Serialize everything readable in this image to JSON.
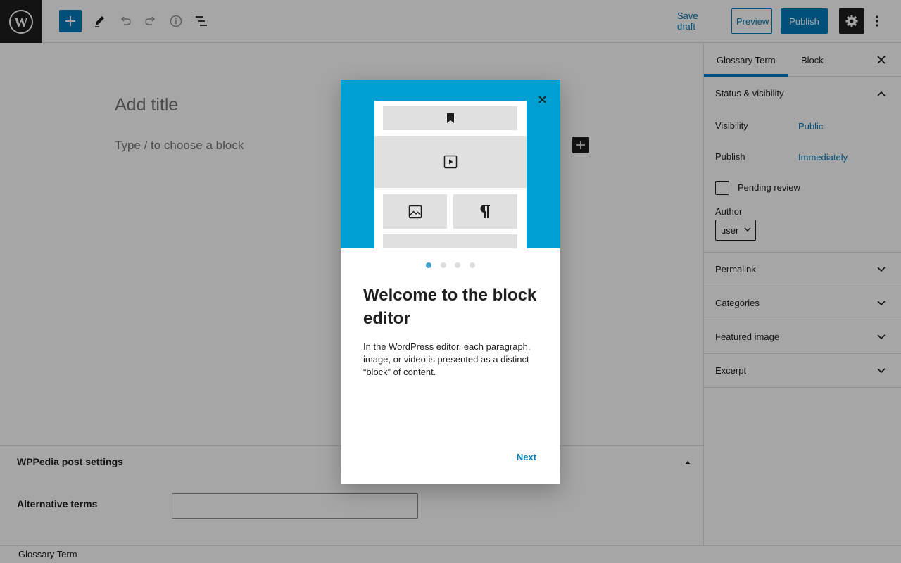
{
  "toolbar": {
    "save_draft": "Save draft",
    "preview": "Preview",
    "publish": "Publish"
  },
  "editor": {
    "title_placeholder": "Add title",
    "block_placeholder": "Type / to choose a block"
  },
  "metabox": {
    "title": "WPPedia post settings",
    "alt_terms_label": "Alternative terms",
    "alt_terms_value": ""
  },
  "footer": {
    "breadcrumb": "Glossary Term"
  },
  "sidebar": {
    "tabs": [
      {
        "label": "Glossary Term",
        "active": true
      },
      {
        "label": "Block",
        "active": false
      }
    ],
    "status_panel": {
      "title": "Status & visibility",
      "visibility_label": "Visibility",
      "visibility_value": "Public",
      "publish_label": "Publish",
      "publish_value": "Immediately",
      "pending_label": "Pending review",
      "author_label": "Author",
      "author_value": "user"
    },
    "panels": [
      {
        "title": "Permalink"
      },
      {
        "title": "Categories"
      },
      {
        "title": "Featured image"
      },
      {
        "title": "Excerpt"
      }
    ]
  },
  "modal": {
    "heading": "Welcome to the block editor",
    "body": "In the WordPress editor, each paragraph, image, or video is presented as a distinct “block” of content.",
    "next_label": "Next",
    "page_current": 1,
    "page_total": 4
  },
  "colors": {
    "accent": "#007cba",
    "hero": "#00a0d2",
    "dark": "#1e1e1e"
  }
}
